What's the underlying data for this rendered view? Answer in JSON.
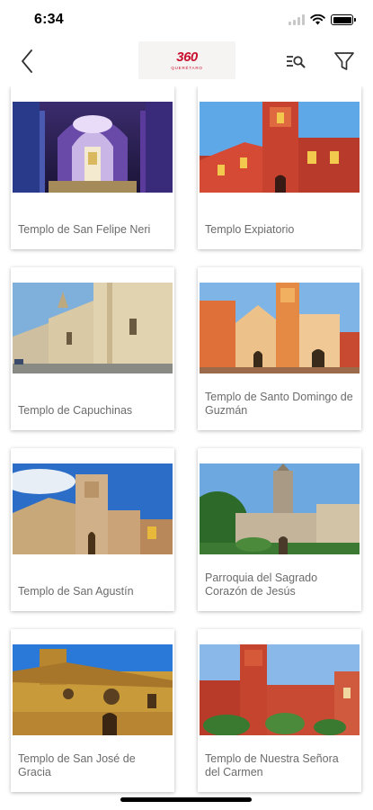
{
  "status": {
    "time": "6:34"
  },
  "header": {
    "logo_mark": "360",
    "logo_sub": "QUERÉTARO",
    "back_icon": "chevron-left-icon",
    "search_list_icon": "list-search-icon",
    "filter_icon": "filter-icon"
  },
  "colors": {
    "brand": "#c8102e",
    "card_text": "#6b6b6b"
  },
  "cards": [
    {
      "title": "Templo de San Felipe Neri"
    },
    {
      "title": "Templo Expiatorio"
    },
    {
      "title": "Templo de Capuchinas"
    },
    {
      "title": "Templo de Santo Domingo de Guzmán"
    },
    {
      "title": "Templo de San Agustín"
    },
    {
      "title": "Parroquia del Sagrado Corazón de Jesús"
    },
    {
      "title": "Templo de San José de Gracia"
    },
    {
      "title": "Templo de Nuestra Señora del Carmen"
    }
  ]
}
